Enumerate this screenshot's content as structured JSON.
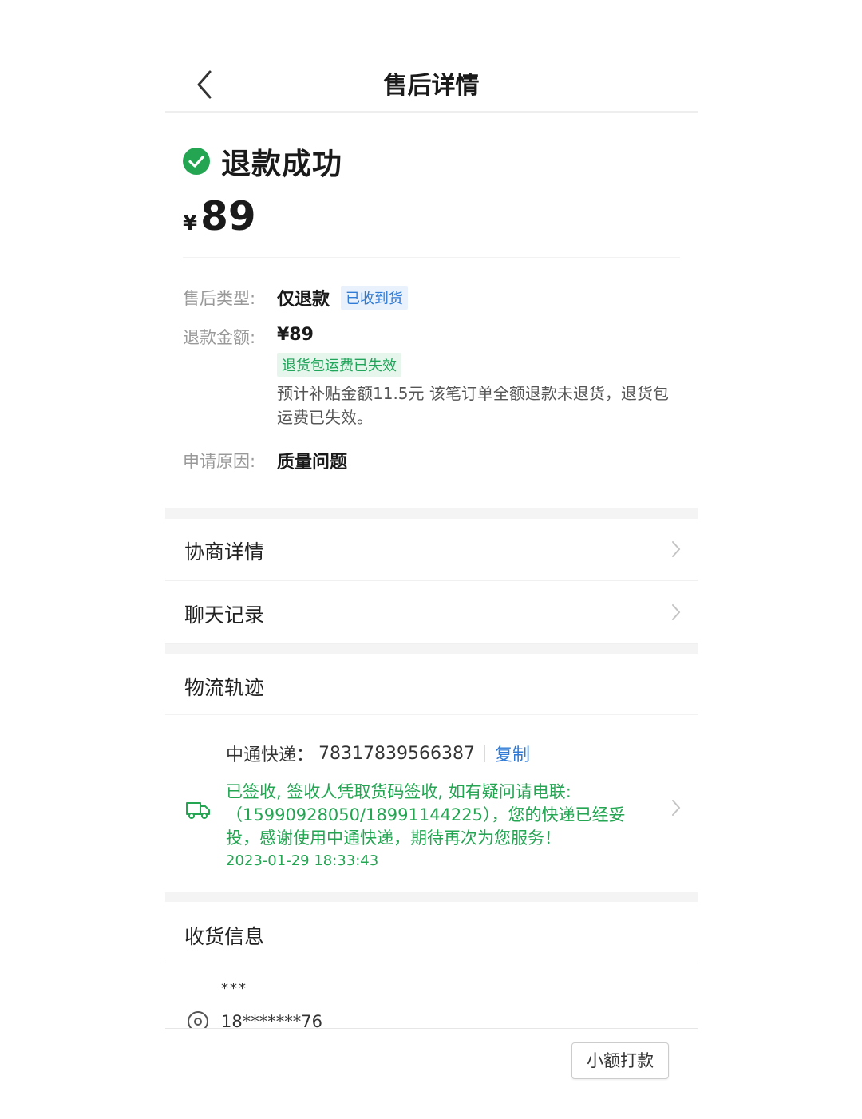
{
  "header": {
    "title": "售后详情"
  },
  "status": {
    "text": "退款成功",
    "currency": "¥",
    "amount": "89"
  },
  "info": {
    "type_label": "售后类型:",
    "type_value": "仅退款",
    "type_tag": "已收到货",
    "amount_label": "退款金额:",
    "amount_value": "¥89",
    "shipping_tag": "退货包运费已失效",
    "note": "预计补贴金额11.5元 该笔订单全额退款未退货，退货包运费已失效。",
    "reason_label": "申请原因:",
    "reason_value": "质量问题"
  },
  "menu": {
    "negotiation": "协商详情",
    "chat": "聊天记录"
  },
  "logistics": {
    "title": "物流轨迹",
    "carrier": "中通快递：",
    "tracking_no": "78317839566387",
    "copy": "复制",
    "message": "已签收, 签收人凭取货码签收, 如有疑问请电联:（15990928050/18991144225），您的快递已经妥投，感谢使用中通快递，期待再次为您服务！",
    "time": "2023-01-29 18:33:43"
  },
  "receiver": {
    "title": "收货信息",
    "name": "***",
    "phone": "18*******76"
  },
  "bottom": {
    "small_pay": "小额打款"
  },
  "colors": {
    "success_green": "#23a552",
    "link_blue": "#2f7bd6"
  }
}
